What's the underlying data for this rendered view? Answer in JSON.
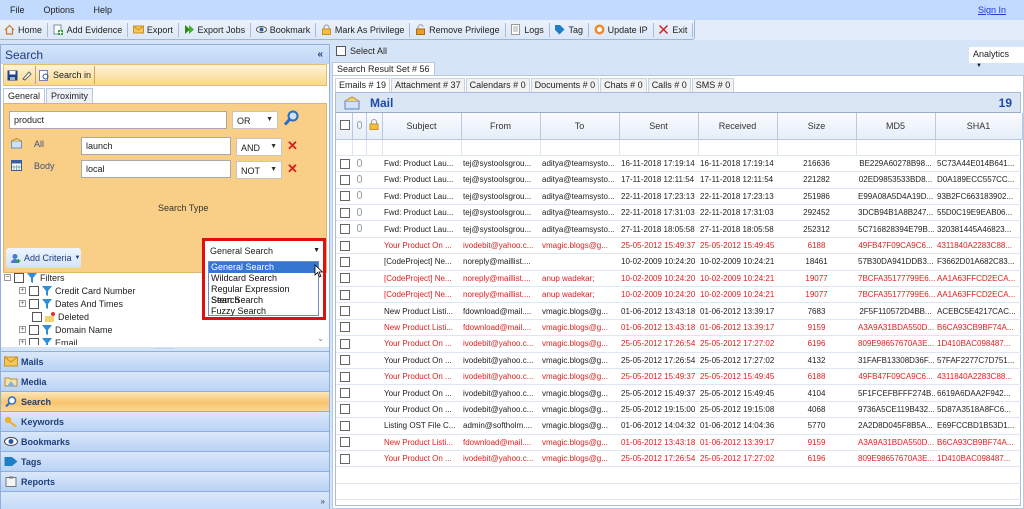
{
  "menu": {
    "items": [
      "File",
      "Options",
      "Help"
    ],
    "sign_in": "Sign In"
  },
  "toolbar": {
    "buttons": [
      {
        "label": "Home",
        "icon": "home-icon"
      },
      {
        "label": "Add Evidence",
        "icon": "add-evidence-icon"
      },
      {
        "label": "Export",
        "icon": "export-icon"
      },
      {
        "label": "Export Jobs",
        "icon": "export-jobs-icon"
      },
      {
        "label": "Bookmark",
        "icon": "eye-icon"
      },
      {
        "label": "Mark As Privilege",
        "icon": "lock-icon"
      },
      {
        "label": "Remove Privilege",
        "icon": "unlock-icon"
      },
      {
        "label": "Logs",
        "icon": "logs-icon"
      },
      {
        "label": "Tag",
        "icon": "tag-icon"
      },
      {
        "label": "Update IP",
        "icon": "update-icon"
      },
      {
        "label": "Exit",
        "icon": "close-icon"
      }
    ]
  },
  "search_panel": {
    "title": "Search",
    "collapse": "«",
    "search_in_label": "Search in",
    "tabs": [
      "General",
      "Proximity"
    ],
    "main_query": "product",
    "main_operator": "OR",
    "criteria": [
      {
        "field": "All",
        "value": "launch",
        "operator": "AND"
      },
      {
        "field": "Body",
        "value": "local",
        "operator": "NOT"
      }
    ],
    "add_criteria_label": "Add Criteria",
    "search_type_label": "Search Type",
    "search_type_value": "General Search",
    "search_type_options": [
      "General Search",
      "Wildcard Search",
      "Regular Expression Search",
      "Stem Search",
      "Fuzzy Search"
    ],
    "filters_root": "Filters",
    "filters": [
      "Credit Card Number",
      "Dates And Times",
      "Deleted",
      "Domain Name",
      "Email"
    ]
  },
  "nav": {
    "items": [
      "Mails",
      "Media",
      "Search",
      "Keywords",
      "Bookmarks",
      "Tags",
      "Reports"
    ],
    "active": "Search"
  },
  "results": {
    "select_all_label": "Select All",
    "analytics_label": "Analytics",
    "result_set_tab": "Search Result Set # 56",
    "category_tabs": [
      "Emails # 19",
      "Attachment # 37",
      "Calendars # 0",
      "Documents # 0",
      "Chats # 0",
      "Calls # 0",
      "SMS # 0"
    ],
    "section_title": "Mail",
    "section_count": "19",
    "columns": [
      "Subject",
      "From",
      "To",
      "Sent",
      "Received",
      "Size",
      "MD5",
      "SHA1"
    ],
    "rows": [
      {
        "red": false,
        "attach": true,
        "subject": "Fwd: Product Lau...",
        "from": "tej@systoolsgrou...",
        "to": "aditya@teamsysto...",
        "sent": "16-11-2018 17:19:14",
        "received": "16-11-2018 17:19:14",
        "size": "216636",
        "md5": "BE229A60278B98...",
        "sha1": "5C73A44E014B641..."
      },
      {
        "red": false,
        "attach": true,
        "subject": "Fwd: Product Lau...",
        "from": "tej@systoolsgrou...",
        "to": "aditya@teamsysto...",
        "sent": "17-11-2018 12:11:54",
        "received": "17-11-2018 12:11:54",
        "size": "221282",
        "md5": "02ED9853533BD8...",
        "sha1": "D0A189ECC557CC..."
      },
      {
        "red": false,
        "attach": true,
        "subject": "Fwd: Product Lau...",
        "from": "tej@systoolsgrou...",
        "to": "aditya@teamsysto...",
        "sent": "22-11-2018 17:23:13",
        "received": "22-11-2018 17:23:13",
        "size": "251986",
        "md5": "E99A08A5D4A19D...",
        "sha1": "93B2FC663183902..."
      },
      {
        "red": false,
        "attach": true,
        "subject": "Fwd: Product Lau...",
        "from": "tej@systoolsgrou...",
        "to": "aditya@teamsysto...",
        "sent": "22-11-2018 17:31:03",
        "received": "22-11-2018 17:31:03",
        "size": "292452",
        "md5": "3DCB94B1A8B247...",
        "sha1": "55D0C19E9EAB06..."
      },
      {
        "red": false,
        "attach": true,
        "subject": "Fwd: Product Lau...",
        "from": "tej@systoolsgrou...",
        "to": "aditya@teamsysto...",
        "sent": "27-11-2018 18:05:58",
        "received": "27-11-2018 18:05:58",
        "size": "252312",
        "md5": "5C716828394E79B...",
        "sha1": "320381445A46823..."
      },
      {
        "red": true,
        "attach": false,
        "subject": "Your Product On ...",
        "from": "ivodebit@yahoo.c...",
        "to": "vmagic.blogs@g...",
        "sent": "25-05-2012 15:49:37",
        "received": "25-05-2012 15:49:45",
        "size": "6188",
        "md5": "49FB47F09CA9C6...",
        "sha1": "4311840A2283C88..."
      },
      {
        "red": false,
        "attach": false,
        "subject": "[CodeProject] Ne...",
        "from": "noreply@maillist....",
        "to": "",
        "sent": "10-02-2009 10:24:20",
        "received": "10-02-2009 10:24:21",
        "size": "18461",
        "md5": "57B30DA941DDB3...",
        "sha1": "F3662D01A682C83..."
      },
      {
        "red": true,
        "attach": false,
        "subject": "[CodeProject] Ne...",
        "from": "noreply@maillist....",
        "to": "anup wadekar;",
        "sent": "10-02-2009 10:24:20",
        "received": "10-02-2009 10:24:21",
        "size": "19077",
        "md5": "7BCFA35177799E6...",
        "sha1": "AA1A63FFCD2ECA..."
      },
      {
        "red": true,
        "attach": false,
        "subject": "[CodeProject] Ne...",
        "from": "noreply@maillist....",
        "to": "anup wadekar;",
        "sent": "10-02-2009 10:24:20",
        "received": "10-02-2009 10:24:21",
        "size": "19077",
        "md5": "7BCFA35177799E6...",
        "sha1": "AA1A63FFCD2ECA..."
      },
      {
        "red": false,
        "attach": false,
        "subject": "New Product Listi...",
        "from": "fdownload@mail....",
        "to": "vmagic.blogs@g...",
        "sent": "01-06-2012 13:43:18",
        "received": "01-06-2012 13:39:17",
        "size": "7683",
        "md5": "2F5F110572D4BB...",
        "sha1": "ACEBC5E4217CAC..."
      },
      {
        "red": true,
        "attach": false,
        "subject": "New Product Listi...",
        "from": "fdownload@mail....",
        "to": "vmagic.blogs@g...",
        "sent": "01-06-2012 13:43:18",
        "received": "01-06-2012 13:39:17",
        "size": "9159",
        "md5": "A3A9A31BDA550D...",
        "sha1": "B6CA93CB9BF74A..."
      },
      {
        "red": true,
        "attach": false,
        "subject": "Your Product On ...",
        "from": "ivodebit@yahoo.c...",
        "to": "vmagic.blogs@g...",
        "sent": "25-05-2012 17:26:54",
        "received": "25-05-2012 17:27:02",
        "size": "6196",
        "md5": "809E98657670A3E...",
        "sha1": "1D410BAC098487..."
      },
      {
        "red": false,
        "attach": false,
        "subject": "Your Product On ...",
        "from": "ivodebit@yahoo.c...",
        "to": "vmagic.blogs@g...",
        "sent": "25-05-2012 17:26:54",
        "received": "25-05-2012 17:27:02",
        "size": "4132",
        "md5": "31FAFB13308D36F...",
        "sha1": "57FAF2277C7D751..."
      },
      {
        "red": true,
        "attach": false,
        "subject": "Your Product On ...",
        "from": "ivodebit@yahoo.c...",
        "to": "vmagic.blogs@g...",
        "sent": "25-05-2012 15:49:37",
        "received": "25-05-2012 15:49:45",
        "size": "6188",
        "md5": "49FB47F09CA9C6...",
        "sha1": "4311840A2283C88..."
      },
      {
        "red": false,
        "attach": false,
        "subject": "Your Product On ...",
        "from": "ivodebit@yahoo.c...",
        "to": "vmagic.blogs@g...",
        "sent": "25-05-2012 15:49:37",
        "received": "25-05-2012 15:49:45",
        "size": "4104",
        "md5": "5F1FCEFBFFF274B...",
        "sha1": "6619A6DAA2F942..."
      },
      {
        "red": false,
        "attach": false,
        "subject": "Your Product On ...",
        "from": "ivodebit@yahoo.c...",
        "to": "vmagic.blogs@g...",
        "sent": "25-05-2012 19:15:00",
        "received": "25-05-2012 19:15:08",
        "size": "4068",
        "md5": "9736A5CE119B432...",
        "sha1": "5D87A3518A8FC6..."
      },
      {
        "red": false,
        "attach": false,
        "subject": "Listing OST File C...",
        "from": "admin@softholm....",
        "to": "vmagic.blogs@g...",
        "sent": "01-06-2012 14:04:32",
        "received": "01-06-2012 14:04:36",
        "size": "5770",
        "md5": "2A2D8D045F8B5A...",
        "sha1": "E69FCCBD1B53D1..."
      },
      {
        "red": true,
        "attach": false,
        "subject": "New Product Listi...",
        "from": "fdownload@mail....",
        "to": "vmagic.blogs@g...",
        "sent": "01-06-2012 13:43:18",
        "received": "01-06-2012 13:39:17",
        "size": "9159",
        "md5": "A3A9A31BDA550D...",
        "sha1": "B6CA93CB9BF74A..."
      },
      {
        "red": true,
        "attach": false,
        "subject": "Your Product On ...",
        "from": "ivodebit@yahoo.c...",
        "to": "vmagic.blogs@g...",
        "sent": "25-05-2012 17:26:54",
        "received": "25-05-2012 17:27:02",
        "size": "6196",
        "md5": "809E98657670A3E...",
        "sha1": "1D410BAC098487..."
      }
    ]
  },
  "colors": {
    "accent": "#1d4aa3",
    "flagged_row": "#e02020",
    "highlight_box": "#e01010",
    "criteria_bg": "#f9cf87"
  }
}
